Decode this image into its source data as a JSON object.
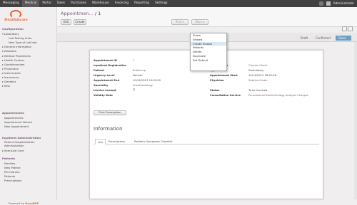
{
  "topbar": {
    "menu": [
      "Messaging",
      "Medical",
      "Portal",
      "Sales",
      "Purchases",
      "Warehouse",
      "Invoicing",
      "Reporting",
      "Settings"
    ],
    "active_index": 1,
    "user": "Administrator"
  },
  "sidebar": {
    "logo_text": "Health&care",
    "sections": [
      {
        "title": "Configuration",
        "items": [
          "Laboratory",
          "Lab Testing Units",
          "New Type of Lab test",
          "General Information",
          "Diseases",
          "Medical Procedures",
          "Health Centers",
          "Questionnaires",
          "Physicians",
          "Instruments",
          "Insurances",
          "Genetics",
          "Misc"
        ]
      },
      {
        "title": "Appointments",
        "items": [
          "Appointments",
          "Appointment Wizard",
          "New Appointment"
        ]
      },
      {
        "title": "Inpatient Administration",
        "items": [
          "Patient Hospitalization Administration",
          "Intensive Care"
        ]
      },
      {
        "title": "Patients",
        "items": [
          "Families",
          "New Patient",
          "Pet Owners",
          "Patients",
          "Prescriptions"
        ]
      }
    ],
    "footer_prefix": "Powered by",
    "footer_brand": "HyvaERP"
  },
  "header": {
    "breadcrumb_link": "Appointmen...",
    "breadcrumb_sep": "/",
    "breadcrumb_id": "1",
    "edit": "Edit",
    "create": "Create",
    "more": "More ▾",
    "print": "Print ▾"
  },
  "dropdown": {
    "items": [
      "Share",
      "Embed",
      "Create Invoice",
      "Patients",
      "Delete",
      "Duplicate",
      "Set Default"
    ],
    "highlighted": 2
  },
  "statusbar": {
    "steps": [
      "Draft",
      "Confirmed",
      "Done"
    ],
    "active": 2
  },
  "form": {
    "appointment_id_label": "Appointment ID",
    "appointment_id": "1",
    "inpatient_label": "Inpatient Registration",
    "patient_label": "Patient",
    "patient": "Buttercup",
    "urgency_label": "Urgency Level",
    "urgency": "Normal",
    "end_label": "Appointment End",
    "end": "10/14/2013 19:02:00",
    "speciality_label": "Speciality",
    "speciality": "Anesthesiology",
    "invoice_label": "Invoice exempt",
    "invoice": "☑",
    "validity_label": "Validity Date",
    "client_label": "Client Name",
    "client": "Charles Chuck",
    "type_label": "Type",
    "type": "Ambulatory",
    "start_label": "Appointment Start",
    "start": "10/14/2013 18:42:56",
    "physician_label": "Physician",
    "physician": "Sabrina Green",
    "status_label": "Status",
    "status": "To be Invoiced",
    "consult_label": "Consultation Service",
    "consult": "Paracetamol Bioch/Carilogy Analysis Charges",
    "print_btn": "Print Prescription",
    "info_title": "Information",
    "tabs": [
      "Info",
      "Prescriptions",
      "Pediatric Symptoms Checklist"
    ]
  }
}
